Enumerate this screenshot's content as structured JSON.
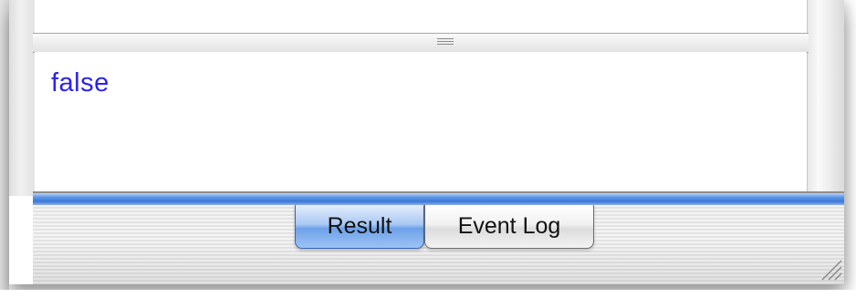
{
  "result_pane": {
    "text": "false",
    "text_color": "#2a22ee"
  },
  "tabs": [
    {
      "label": "Result",
      "selected": true
    },
    {
      "label": "Event Log",
      "selected": false
    }
  ],
  "colors": {
    "selected_tab": "#6da1ea",
    "divider_accent": "#3a78d8"
  },
  "icons": {
    "splitter": "splitter-grip-icon",
    "resize": "resize-grip-icon"
  }
}
